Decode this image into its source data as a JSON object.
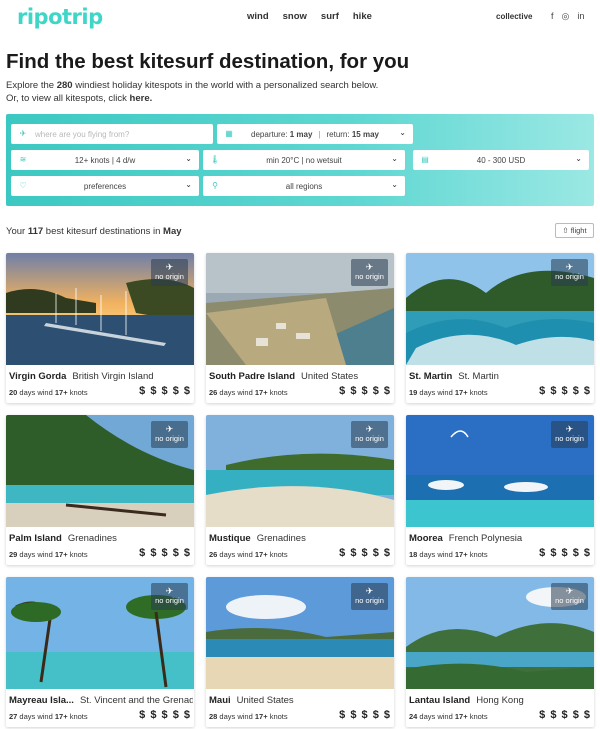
{
  "header": {
    "logo": "ripotrip",
    "nav": [
      "wind",
      "snow",
      "surf",
      "hike"
    ],
    "collective": "collective",
    "social": [
      "f",
      "◎",
      "in"
    ]
  },
  "hero": {
    "title": "Find the best kitesurf destination, for you",
    "sub1_pre": "Explore the ",
    "sub1_count": "280",
    "sub1_post": " windiest holiday kitespots in the world with a personalized search below.",
    "sub2_pre": "Or, to view all kitespots, click ",
    "sub2_link": "here."
  },
  "search": {
    "origin_placeholder": "where are you flying from?",
    "departure_label": "departure:",
    "departure_value": "1 may",
    "return_label": "return:",
    "return_value": "15 may",
    "wind": "12+ knots | 4 d/w",
    "temp": "min 20°C | no wetsuit",
    "budget": "40 - 300 USD",
    "preferences": "preferences",
    "regions": "all regions"
  },
  "results": {
    "pre": "Your ",
    "count": "117",
    "mid": " best kitesurf destinations in ",
    "month": "May",
    "flight_button": "flight"
  },
  "cards": [
    {
      "name": "Virgin Gorda",
      "country": "British Virgin Island",
      "days": "20",
      "wind": "17+",
      "price": "$ $ $ $ $",
      "badge": "no origin"
    },
    {
      "name": "South Padre Island",
      "country": "United States",
      "days": "26",
      "wind": "17+",
      "price": "$ $ $ $ $",
      "badge": "no origin"
    },
    {
      "name": "St. Martin",
      "country": "St. Martin",
      "days": "19",
      "wind": "17+",
      "price": "$ $ $ $ $",
      "badge": "no origin"
    },
    {
      "name": "Palm Island",
      "country": "Grenadines",
      "days": "29",
      "wind": "17+",
      "price": "$ $ $ $ $",
      "badge": "no origin"
    },
    {
      "name": "Mustique",
      "country": "Grenadines",
      "days": "26",
      "wind": "17+",
      "price": "$ $ $ $ $",
      "badge": "no origin"
    },
    {
      "name": "Moorea",
      "country": "French Polynesia",
      "days": "18",
      "wind": "17+",
      "price": "$ $ $ $ $",
      "badge": "no origin"
    },
    {
      "name": "Mayreau Isla...",
      "country": "St. Vincent and the Grenadi...",
      "days": "27",
      "wind": "17+",
      "price": "$ $ $ $ $",
      "badge": "no origin"
    },
    {
      "name": "Maui",
      "country": "United States",
      "days": "28",
      "wind": "17+",
      "price": "$ $ $ $ $",
      "badge": "no origin"
    },
    {
      "name": "Lantau Island",
      "country": "Hong Kong",
      "days": "24",
      "wind": "17+",
      "price": "$ $ $ $ $",
      "badge": "no origin"
    }
  ],
  "card_text": {
    "days_suffix": " days wind ",
    "knots_suffix": " knots"
  },
  "colors": {
    "brand": "#3ed6c6",
    "panel_start": "#3cc8c2",
    "panel_end": "#9be8e4"
  }
}
